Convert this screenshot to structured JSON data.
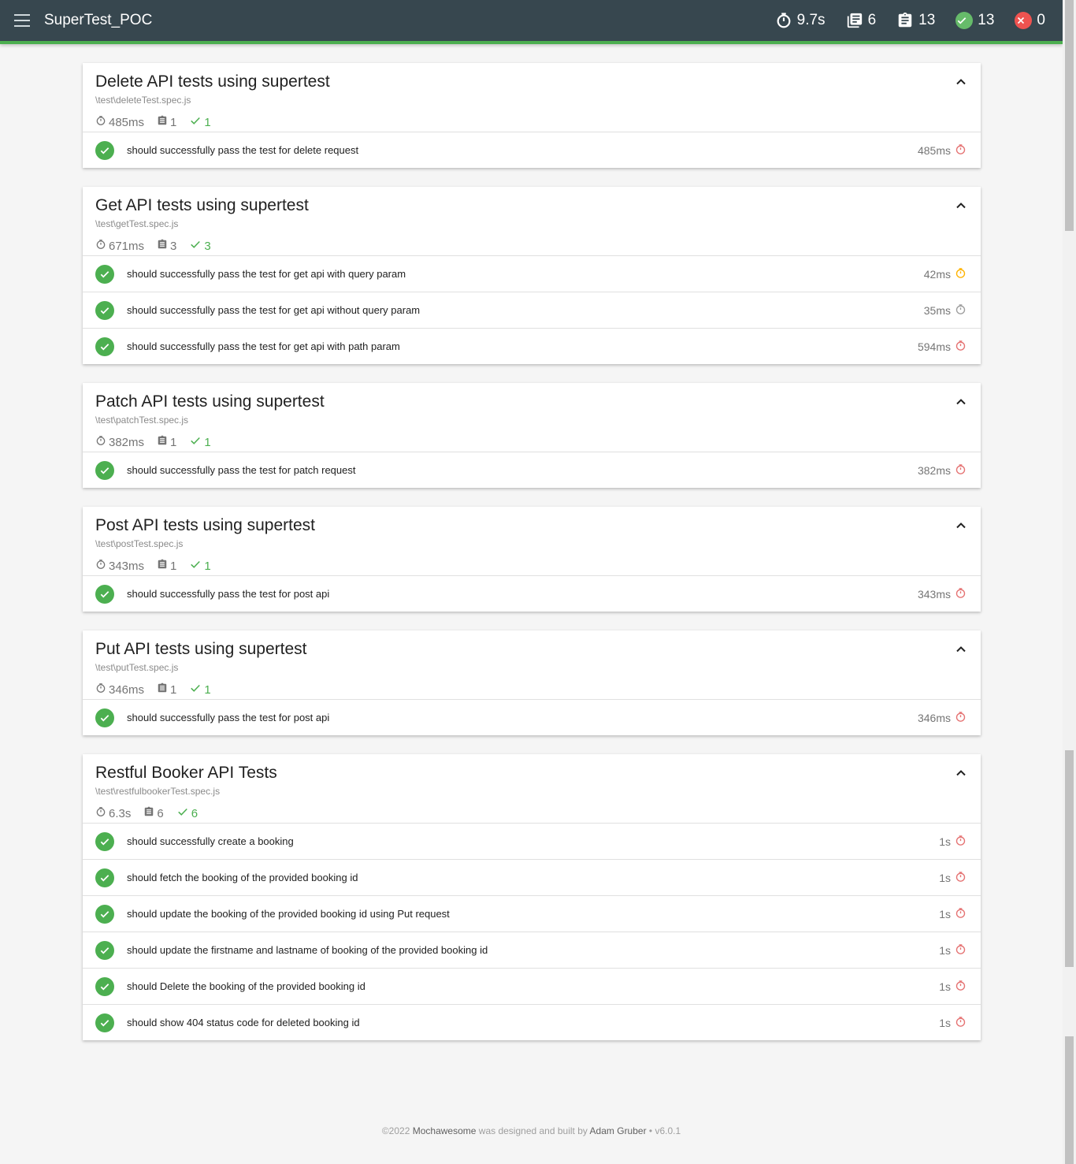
{
  "app": {
    "title": "SuperTest_POC"
  },
  "header_stats": {
    "duration": "9.7s",
    "suites": "6",
    "tests": "13",
    "passed": "13",
    "failed": "0"
  },
  "colors": {
    "topbar": "#37474f",
    "pass": "#4caf50",
    "fail": "#ef5350",
    "slow": "#e57373",
    "medium": "#ffb300",
    "fast": "#9e9e9e"
  },
  "suites": [
    {
      "title": "Delete API tests using supertest",
      "file": "\\test\\deleteTest.spec.js",
      "duration": "485ms",
      "tests": "1",
      "passes": "1",
      "items": [
        {
          "title": "should successfully pass the test for delete request",
          "duration": "485ms",
          "speed": "slow"
        }
      ]
    },
    {
      "title": "Get API tests using supertest",
      "file": "\\test\\getTest.spec.js",
      "duration": "671ms",
      "tests": "3",
      "passes": "3",
      "items": [
        {
          "title": "should successfully pass the test for get api with query param",
          "duration": "42ms",
          "speed": "medium"
        },
        {
          "title": "should successfully pass the test for get api without query param",
          "duration": "35ms",
          "speed": "fast"
        },
        {
          "title": "should successfully pass the test for get api with path param",
          "duration": "594ms",
          "speed": "slow"
        }
      ]
    },
    {
      "title": "Patch API tests using supertest",
      "file": "\\test\\patchTest.spec.js",
      "duration": "382ms",
      "tests": "1",
      "passes": "1",
      "items": [
        {
          "title": "should successfully pass the test for patch request",
          "duration": "382ms",
          "speed": "slow"
        }
      ]
    },
    {
      "title": "Post API tests using supertest",
      "file": "\\test\\postTest.spec.js",
      "duration": "343ms",
      "tests": "1",
      "passes": "1",
      "items": [
        {
          "title": "should successfully pass the test for post api",
          "duration": "343ms",
          "speed": "slow"
        }
      ]
    },
    {
      "title": "Put API tests using supertest",
      "file": "\\test\\putTest.spec.js",
      "duration": "346ms",
      "tests": "1",
      "passes": "1",
      "items": [
        {
          "title": "should successfully pass the test for post api",
          "duration": "346ms",
          "speed": "slow"
        }
      ]
    },
    {
      "title": "Restful Booker API Tests",
      "file": "\\test\\restfulbookerTest.spec.js",
      "duration": "6.3s",
      "tests": "6",
      "passes": "6",
      "items": [
        {
          "title": "should successfully create a booking",
          "duration": "1s",
          "speed": "slow"
        },
        {
          "title": "should fetch the booking of the provided booking id",
          "duration": "1s",
          "speed": "slow"
        },
        {
          "title": "should update the booking of the provided booking id using Put request",
          "duration": "1s",
          "speed": "slow"
        },
        {
          "title": "should update the firstname and lastname of booking of the provided booking id",
          "duration": "1s",
          "speed": "slow"
        },
        {
          "title": "should Delete the booking of the provided booking id",
          "duration": "1s",
          "speed": "slow"
        },
        {
          "title": "should show 404 status code for deleted booking id",
          "duration": "1s",
          "speed": "slow"
        }
      ]
    }
  ],
  "footer": {
    "copyright": "©2022",
    "product": "Mochawesome",
    "middle": "was designed and built by",
    "author": "Adam Gruber",
    "version": "• v6.0.1"
  }
}
